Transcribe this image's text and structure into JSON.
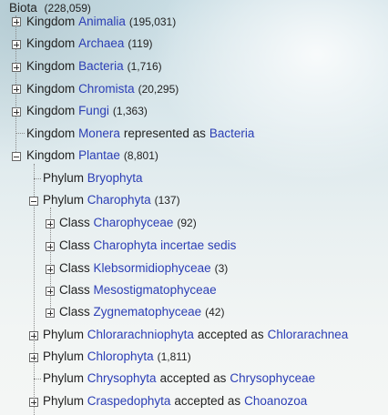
{
  "root": {
    "label": "Biota",
    "count": "(228,059)"
  },
  "kingdoms": [
    {
      "rank": "Kingdom",
      "name": "Animalia",
      "count": "(195,031)",
      "toggle": "plus"
    },
    {
      "rank": "Kingdom",
      "name": "Archaea",
      "count": "(119)",
      "toggle": "plus"
    },
    {
      "rank": "Kingdom",
      "name": "Bacteria",
      "count": "(1,716)",
      "toggle": "plus"
    },
    {
      "rank": "Kingdom",
      "name": "Chromista",
      "count": "(20,295)",
      "toggle": "plus"
    },
    {
      "rank": "Kingdom",
      "name": "Fungi",
      "count": "(1,363)",
      "toggle": "plus"
    },
    {
      "rank": "Kingdom",
      "name": "Monera",
      "status": "represented as",
      "target": "Bacteria",
      "toggle": "none"
    },
    {
      "rank": "Kingdom",
      "name": "Plantae",
      "count": "(8,801)",
      "toggle": "minus"
    }
  ],
  "plantae_children": [
    {
      "rank": "Phylum",
      "name": "Bryophyta",
      "toggle": "none"
    },
    {
      "rank": "Phylum",
      "name": "Charophyta",
      "count": "(137)",
      "toggle": "minus"
    }
  ],
  "charophyta_children": [
    {
      "rank": "Class",
      "name": "Charophyceae",
      "count": "(92)",
      "toggle": "plus"
    },
    {
      "rank": "Class",
      "name": "Charophyta incertae sedis",
      "toggle": "plus"
    },
    {
      "rank": "Class",
      "name": "Klebsormidiophyceae",
      "count": "(3)",
      "toggle": "plus"
    },
    {
      "rank": "Class",
      "name": "Mesostigmatophyceae",
      "toggle": "plus"
    },
    {
      "rank": "Class",
      "name": "Zygnematophyceae",
      "count": "(42)",
      "toggle": "plus"
    }
  ],
  "more_phyla": [
    {
      "rank": "Phylum",
      "name": "Chlorarachniophyta",
      "status": "accepted as",
      "target": "Chlorarachnea",
      "toggle": "plus"
    },
    {
      "rank": "Phylum",
      "name": "Chlorophyta",
      "count": "(1,811)",
      "toggle": "plus"
    },
    {
      "rank": "Phylum",
      "name": "Chrysophyta",
      "status": "accepted as",
      "target": "Chrysophyceae",
      "toggle": "none"
    },
    {
      "rank": "Phylum",
      "name": "Craspedophyta",
      "status": "accepted as",
      "target": "Choanozoa",
      "toggle": "plus"
    }
  ],
  "colors": {
    "link": "#2b3eb5",
    "text": "#222222"
  }
}
